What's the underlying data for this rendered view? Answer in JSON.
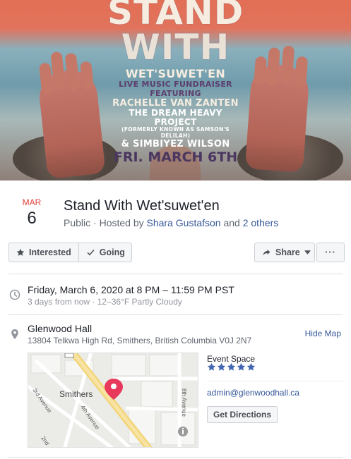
{
  "cover": {
    "line1": "STAND",
    "line2": "WITH",
    "line3": "WET'SUWET'EN",
    "line4": "LIVE MUSIC FUNDRAISER FEATURING",
    "line5": "RACHELLE VAN ZANTEN",
    "line6": "THE DREAM HEAVY PROJECT",
    "line7": "(FORMERLY KNOWN AS SAMSON'S DELILAH)",
    "line8": "& SIMBIYEZ WILSON",
    "line9": "FRI. MARCH 6TH"
  },
  "event": {
    "month": "MAR",
    "day": "6",
    "title": "Stand With Wet'suwet'en",
    "privacy": "Public",
    "hosted_prefix": "· Hosted by",
    "host": "Shara Gustafson",
    "and": "and",
    "others": "2 others"
  },
  "actions": {
    "interested": "Interested",
    "going": "Going",
    "share": "Share",
    "more": "···"
  },
  "time": {
    "main": "Friday, March 6, 2020 at 8 PM – 11:59 PM PST",
    "sub": "3 days from now · 12–36°F Partly Cloudy"
  },
  "location": {
    "name": "Glenwood Hall",
    "address": "13804 Telkwa High Rd, Smithers, British Columbia V0J 2N7",
    "hide_map": "Hide Map"
  },
  "map": {
    "city": "Smithers",
    "street1": "3rd Avenue",
    "street2": "4th Avenue",
    "street3": "8th Avenue",
    "street4": "2nd"
  },
  "venue": {
    "category": "Event Space",
    "rating_stars": 5,
    "email": "admin@glenwoodhall.ca",
    "directions": "Get Directions"
  },
  "colors": {
    "date_month": "#e4413d",
    "link": "#365899",
    "star": "#4267b2",
    "pin": "#e8395d"
  }
}
